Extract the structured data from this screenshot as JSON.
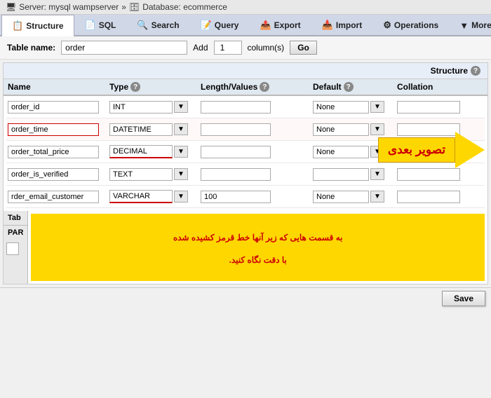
{
  "breadcrumb": {
    "server_icon": "🖥",
    "server_label": "Server: mysql wampserver",
    "separator1": "»",
    "database_icon": "🗄",
    "database_label": "Database: ecommerce"
  },
  "nav": {
    "tabs": [
      {
        "id": "structure",
        "icon": "📋",
        "label": "Structure",
        "active": true
      },
      {
        "id": "sql",
        "icon": "📄",
        "label": "SQL",
        "active": false
      },
      {
        "id": "search",
        "icon": "🔍",
        "label": "Search",
        "active": false
      },
      {
        "id": "query",
        "icon": "📝",
        "label": "Query",
        "active": false
      },
      {
        "id": "export",
        "icon": "📤",
        "label": "Export",
        "active": false
      },
      {
        "id": "import",
        "icon": "📥",
        "label": "Import",
        "active": false
      },
      {
        "id": "operations",
        "icon": "⚙",
        "label": "Operations",
        "active": false
      },
      {
        "id": "more",
        "icon": "▼",
        "label": "More",
        "active": false
      }
    ]
  },
  "table_name_bar": {
    "label": "Table name:",
    "value": "order",
    "add_label": "Add",
    "add_value": "1",
    "columns_label": "column(s)",
    "go_label": "Go"
  },
  "structure_section": {
    "header": "Structure",
    "columns": [
      {
        "label": "Name",
        "id": "name"
      },
      {
        "label": "Type",
        "id": "type"
      },
      {
        "label": "Length/Values",
        "id": "length"
      },
      {
        "label": "Default",
        "id": "default"
      },
      {
        "label": "Collation",
        "id": "collation"
      }
    ],
    "rows": [
      {
        "name": "order_id",
        "type": "INT",
        "type_highlighted": false,
        "length": "",
        "default": "None",
        "collation": "",
        "name_highlighted": false
      },
      {
        "name": "order_time",
        "type": "DATETIME",
        "type_highlighted": false,
        "length": "",
        "default": "None",
        "collation": "",
        "name_highlighted": true
      },
      {
        "name": "order_total_price",
        "type": "DECIMAL",
        "type_highlighted": true,
        "length": "",
        "default": "None",
        "collation": "",
        "name_highlighted": false,
        "has_arrow": true,
        "arrow_text": "تصویر بعدی"
      },
      {
        "name": "order_is_verified",
        "type": "TEXT",
        "type_highlighted": false,
        "length": "",
        "default": "",
        "collation": "",
        "name_highlighted": false
      },
      {
        "name": "rder_email_customer",
        "type": "VARCHAR",
        "type_highlighted": true,
        "length": "100",
        "default": "None",
        "collation": "",
        "name_highlighted": false
      }
    ]
  },
  "annotation": {
    "text_line1": "به قسمت هایی که زیر آنها خط قرمز کشیده شده",
    "text_line2": "با دقت نگاه کنید."
  },
  "tab_section": {
    "tab_label": "Tab",
    "par_label": "PAR"
  },
  "save_button_label": "Save"
}
